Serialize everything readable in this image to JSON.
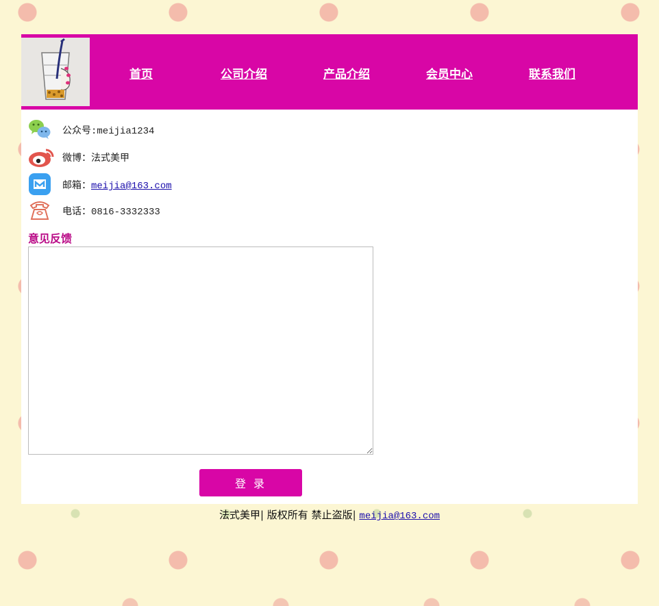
{
  "nav": {
    "items": [
      {
        "label": "首页"
      },
      {
        "label": "公司介绍"
      },
      {
        "label": "产品介绍"
      },
      {
        "label": "会员中心"
      },
      {
        "label": "联系我们"
      }
    ]
  },
  "contact": {
    "wechat": "公众号:meijia1234",
    "weibo": "微博：法式美甲",
    "email_prefix": "邮箱：",
    "email": "meijia@163.com",
    "phone": "电话：0816-3332333"
  },
  "feedback": {
    "title": "意见反馈",
    "value": ""
  },
  "login_button": "登 录",
  "footer": {
    "brand": "法式美甲",
    "sep1": "|",
    "rights": "版权所有 禁止盗版",
    "sep2": "|",
    "email": "meijia@163.com"
  },
  "colors": {
    "brand_magenta": "#d806a6",
    "page_bg": "#fcf6d3",
    "feedback_title": "#b90a86",
    "link": "#1a0dab"
  },
  "icons": {
    "wechat": "wechat-icon",
    "weibo": "weibo-icon",
    "mail": "mail-app-icon",
    "phone": "telephone-icon"
  }
}
